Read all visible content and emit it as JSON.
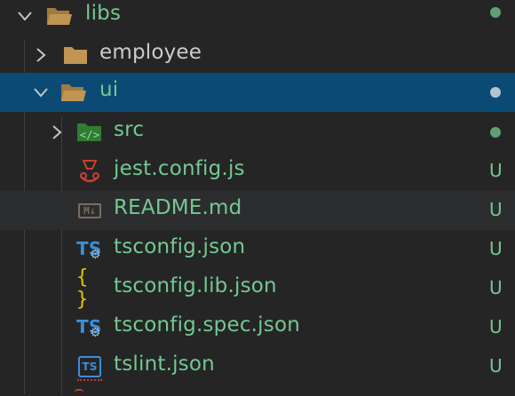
{
  "explorer": {
    "items": [
      {
        "label": "libs",
        "kind": "folder",
        "expanded": true,
        "status": "dot"
      },
      {
        "label": "employee",
        "kind": "folder",
        "expanded": false,
        "status": ""
      },
      {
        "label": "ui",
        "kind": "folder",
        "expanded": true,
        "status": "dot",
        "selected": true
      },
      {
        "label": "src",
        "kind": "folder",
        "expanded": false,
        "status": "dot"
      },
      {
        "label": "jest.config.js",
        "kind": "file",
        "icon": "jest-icon",
        "status": "U"
      },
      {
        "label": "README.md",
        "kind": "file",
        "icon": "markdown-icon",
        "status": "U"
      },
      {
        "label": "tsconfig.json",
        "kind": "file",
        "icon": "typescript-config-icon",
        "status": "U"
      },
      {
        "label": "tsconfig.lib.json",
        "kind": "file",
        "icon": "json-icon",
        "status": "U"
      },
      {
        "label": "tsconfig.spec.json",
        "kind": "file",
        "icon": "typescript-config-icon",
        "status": "U"
      },
      {
        "label": "tslint.json",
        "kind": "file",
        "icon": "tslint-icon",
        "status": "U"
      }
    ]
  },
  "icons": {
    "md_text": "M↓",
    "braces_text": "{ }",
    "ts_text": "TS",
    "gear_text": "⚙",
    "tslint_text": "TS"
  },
  "colors": {
    "background": "#252526",
    "selected": "#0b4a74",
    "untracked": "#73c991",
    "folder": "#c09553",
    "ts_blue": "#3a8fd9"
  }
}
